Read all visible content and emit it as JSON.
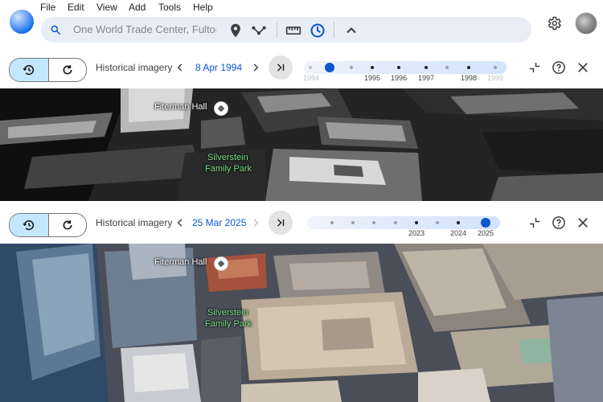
{
  "menu": [
    "File",
    "Edit",
    "View",
    "Add",
    "Tools",
    "Help"
  ],
  "search": {
    "value": "One World Trade Center, Fulton S"
  },
  "icons": {
    "search": "search-icon",
    "pin": "location-pin-icon",
    "path": "path-icon",
    "ruler": "ruler-icon",
    "history": "historical-imagery-icon",
    "collapse": "chevron-up-icon",
    "settings": "gear-icon"
  },
  "top_panel": {
    "label": "Historical imagery",
    "date": "8 Apr 1994",
    "years": [
      "1994",
      "1995",
      "1996",
      "1997",
      "1998",
      "1999"
    ],
    "position": 0.0
  },
  "bottom_panel": {
    "label": "Historical imagery",
    "date": "25 Mar 2025",
    "years": [
      "2023",
      "2024",
      "2025"
    ],
    "position": 1.0
  },
  "map_labels": {
    "building": "Fiterman Hall",
    "park_line1": "Silverstein",
    "park_line2": "Family Park"
  },
  "colors": {
    "accent": "#0b57d0",
    "selected_bg": "#c2e7ff",
    "park_text": "#7ce08a"
  }
}
